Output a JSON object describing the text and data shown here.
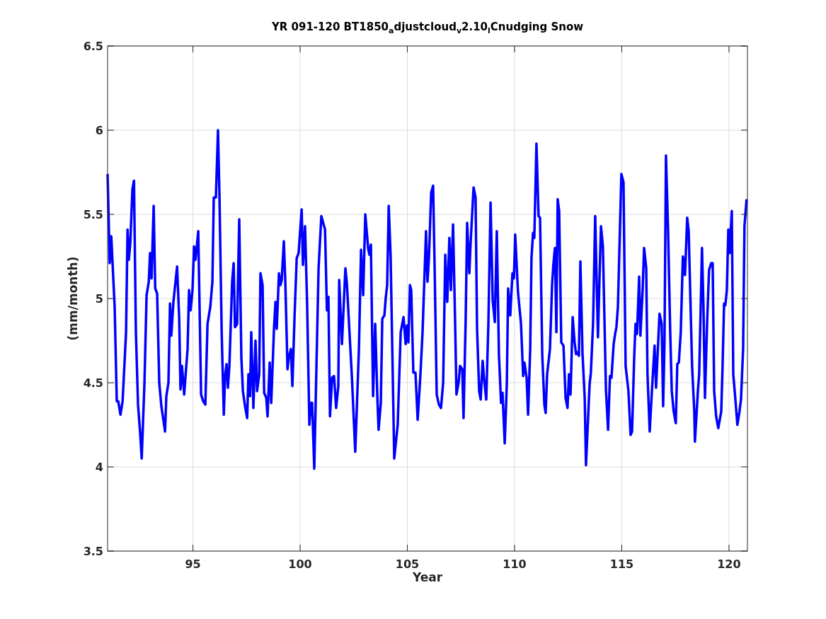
{
  "figure": {
    "chart_data": {
      "type": "line",
      "title": "YR 091-120 BT1850$_{a}$djustcloud$_{v}$2.10$_{l}$Cnudging Snow",
      "xlabel": "Year",
      "ylabel": "(mm/month)",
      "grid": true,
      "xlim": [
        91.02,
        120.86
      ],
      "ylim": [
        3.5,
        6.5
      ],
      "xticks": [
        95,
        100,
        105,
        110,
        115,
        120
      ],
      "yticks": [
        {
          "value": 3.5,
          "label": "3.5"
        },
        {
          "value": 4,
          "label": "4"
        },
        {
          "value": 4.5,
          "label": "4.5"
        },
        {
          "value": 5,
          "label": "5"
        },
        {
          "value": 5.5,
          "label": "5.5"
        },
        {
          "value": 6,
          "label": "6"
        },
        {
          "value": 6.5,
          "label": "6.5"
        }
      ],
      "x": [
        91.02,
        91.12,
        91.19,
        91.35,
        91.45,
        91.52,
        91.62,
        91.72,
        91.88,
        91.95,
        92.01,
        92.08,
        92.18,
        92.25,
        92.34,
        92.44,
        92.54,
        92.61,
        92.74,
        92.84,
        92.94,
        93.0,
        93.07,
        93.17,
        93.24,
        93.33,
        93.43,
        93.53,
        93.7,
        93.76,
        93.86,
        93.93,
        93.99,
        94.09,
        94.26,
        94.36,
        94.42,
        94.49,
        94.59,
        94.75,
        94.82,
        94.89,
        94.98,
        95.05,
        95.12,
        95.25,
        95.38,
        95.48,
        95.58,
        95.68,
        95.81,
        95.91,
        95.97,
        96.07,
        96.17,
        96.24,
        96.34,
        96.44,
        96.5,
        96.57,
        96.63,
        96.7,
        96.83,
        96.9,
        96.96,
        97.06,
        97.16,
        97.26,
        97.33,
        97.43,
        97.53,
        97.59,
        97.66,
        97.72,
        97.82,
        97.92,
        97.99,
        98.09,
        98.15,
        98.25,
        98.32,
        98.42,
        98.48,
        98.58,
        98.65,
        98.78,
        98.85,
        98.91,
        99.01,
        99.08,
        99.14,
        99.24,
        99.31,
        99.41,
        99.47,
        99.57,
        99.64,
        99.74,
        99.84,
        99.93,
        100.07,
        100.13,
        100.23,
        100.33,
        100.43,
        100.5,
        100.56,
        100.66,
        100.76,
        100.86,
        100.99,
        101.16,
        101.25,
        101.32,
        101.39,
        101.49,
        101.58,
        101.68,
        101.78,
        101.82,
        101.95,
        102.11,
        102.18,
        102.28,
        102.41,
        102.57,
        102.74,
        102.84,
        102.94,
        103.04,
        103.17,
        103.23,
        103.3,
        103.4,
        103.5,
        103.6,
        103.66,
        103.76,
        103.83,
        103.93,
        103.99,
        104.06,
        104.13,
        104.22,
        104.39,
        104.55,
        104.69,
        104.82,
        104.92,
        104.98,
        105.05,
        105.12,
        105.18,
        105.28,
        105.38,
        105.48,
        105.61,
        105.71,
        105.87,
        105.94,
        106.01,
        106.11,
        106.2,
        106.27,
        106.37,
        106.47,
        106.57,
        106.67,
        106.77,
        106.86,
        106.96,
        107.03,
        107.13,
        107.23,
        107.29,
        107.39,
        107.46,
        107.56,
        107.62,
        107.72,
        107.79,
        107.89,
        107.95,
        108.09,
        108.18,
        108.25,
        108.35,
        108.42,
        108.51,
        108.58,
        108.68,
        108.78,
        108.88,
        108.98,
        109.08,
        109.17,
        109.27,
        109.37,
        109.44,
        109.54,
        109.64,
        109.7,
        109.8,
        109.9,
        109.97,
        110.03,
        110.16,
        110.3,
        110.4,
        110.46,
        110.56,
        110.63,
        110.73,
        110.79,
        110.86,
        110.92,
        111.02,
        111.12,
        111.19,
        111.29,
        111.39,
        111.45,
        111.52,
        111.65,
        111.75,
        111.81,
        111.88,
        111.95,
        112.01,
        112.08,
        112.18,
        112.28,
        112.38,
        112.47,
        112.54,
        112.61,
        112.71,
        112.8,
        112.87,
        112.94,
        113.0,
        113.07,
        113.17,
        113.27,
        113.33,
        113.5,
        113.56,
        113.66,
        113.76,
        113.89,
        113.96,
        114.03,
        114.12,
        114.26,
        114.36,
        114.45,
        114.52,
        114.62,
        114.69,
        114.75,
        114.82,
        114.98,
        115.08,
        115.18,
        115.31,
        115.41,
        115.48,
        115.58,
        115.64,
        115.71,
        115.81,
        115.87,
        115.97,
        116.04,
        116.14,
        116.2,
        116.3,
        116.4,
        116.53,
        116.6,
        116.76,
        116.86,
        116.93,
        116.99,
        117.06,
        117.16,
        117.26,
        117.33,
        117.42,
        117.52,
        117.59,
        117.66,
        117.75,
        117.85,
        117.95,
        118.05,
        118.12,
        118.18,
        118.28,
        118.38,
        118.41,
        118.55,
        118.61,
        118.68,
        118.74,
        118.81,
        118.88,
        118.98,
        119.07,
        119.17,
        119.24,
        119.31,
        119.4,
        119.5,
        119.64,
        119.7,
        119.77,
        119.83,
        119.9,
        119.97,
        120.03,
        120.13,
        120.2,
        120.3,
        120.39,
        120.49,
        120.56,
        120.66,
        120.72,
        120.82
      ],
      "series": [
        {
          "color": "#0000ff",
          "values": [
            5.74,
            5.21,
            5.37,
            4.95,
            4.39,
            4.39,
            4.31,
            4.39,
            4.8,
            5.41,
            5.23,
            5.33,
            5.65,
            5.7,
            4.8,
            4.37,
            4.2,
            4.05,
            4.5,
            5.02,
            5.1,
            5.27,
            5.12,
            5.55,
            5.06,
            5.03,
            4.5,
            4.36,
            4.21,
            4.42,
            4.5,
            4.97,
            4.78,
            4.98,
            5.19,
            4.88,
            4.46,
            4.6,
            4.43,
            4.7,
            5.05,
            4.93,
            5.05,
            5.31,
            5.23,
            5.4,
            4.43,
            4.39,
            4.37,
            4.85,
            4.95,
            5.1,
            5.6,
            5.6,
            6.0,
            5.6,
            4.8,
            4.31,
            4.54,
            4.61,
            4.47,
            4.6,
            5.1,
            5.21,
            4.83,
            4.85,
            5.47,
            4.65,
            4.45,
            4.36,
            4.29,
            4.55,
            4.42,
            4.8,
            4.35,
            4.75,
            4.45,
            4.55,
            5.15,
            5.08,
            4.44,
            4.41,
            4.3,
            4.62,
            4.38,
            4.82,
            4.98,
            4.82,
            5.15,
            5.08,
            5.11,
            5.34,
            5.1,
            4.58,
            4.65,
            4.7,
            4.48,
            4.9,
            5.24,
            5.27,
            5.53,
            5.2,
            5.43,
            4.95,
            4.25,
            4.38,
            4.38,
            3.99,
            4.6,
            5.18,
            5.49,
            5.41,
            4.93,
            5.01,
            4.3,
            4.53,
            4.54,
            4.35,
            4.48,
            5.11,
            4.73,
            5.18,
            5.09,
            4.85,
            4.54,
            4.09,
            4.7,
            5.29,
            5.02,
            5.5,
            5.3,
            5.26,
            5.32,
            4.42,
            4.85,
            4.42,
            4.22,
            4.38,
            4.88,
            4.9,
            5.0,
            5.08,
            5.55,
            5.25,
            4.05,
            4.25,
            4.8,
            4.89,
            4.73,
            4.84,
            4.74,
            5.08,
            5.05,
            4.56,
            4.56,
            4.28,
            4.55,
            4.8,
            5.4,
            5.1,
            5.25,
            5.63,
            5.67,
            5.2,
            4.43,
            4.37,
            4.35,
            4.5,
            5.26,
            4.98,
            5.36,
            5.05,
            5.44,
            4.84,
            4.43,
            4.5,
            4.6,
            4.58,
            4.29,
            4.87,
            5.45,
            5.15,
            5.33,
            5.66,
            5.6,
            4.82,
            4.45,
            4.4,
            4.63,
            4.52,
            4.4,
            4.85,
            5.57,
            4.99,
            4.86,
            5.4,
            4.67,
            4.38,
            4.44,
            4.14,
            4.5,
            5.06,
            4.9,
            5.15,
            5.12,
            5.38,
            5.04,
            4.85,
            4.54,
            4.62,
            4.53,
            4.31,
            4.7,
            5.24,
            5.39,
            5.36,
            5.92,
            5.49,
            5.48,
            4.67,
            4.37,
            4.32,
            4.55,
            4.7,
            5.08,
            5.2,
            5.3,
            4.8,
            5.59,
            5.52,
            4.74,
            4.72,
            4.41,
            4.35,
            4.55,
            4.43,
            4.89,
            4.74,
            4.67,
            4.68,
            4.66,
            5.22,
            4.67,
            4.41,
            4.01,
            4.49,
            4.56,
            4.85,
            5.49,
            4.77,
            5.12,
            5.43,
            5.31,
            4.46,
            4.22,
            4.54,
            4.53,
            4.73,
            4.79,
            4.83,
            4.95,
            5.74,
            5.69,
            4.6,
            4.45,
            4.19,
            4.21,
            4.65,
            4.85,
            4.79,
            5.13,
            4.78,
            5.05,
            5.3,
            5.18,
            4.55,
            4.21,
            4.44,
            4.72,
            4.47,
            4.91,
            4.85,
            4.36,
            4.73,
            5.85,
            5.4,
            4.8,
            4.45,
            4.33,
            4.26,
            4.61,
            4.62,
            4.8,
            5.25,
            5.14,
            5.48,
            5.4,
            5.1,
            4.6,
            4.33,
            4.15,
            4.45,
            4.55,
            4.95,
            5.3,
            4.95,
            4.41,
            4.85,
            5.17,
            5.21,
            5.21,
            4.45,
            4.3,
            4.23,
            4.33,
            4.6,
            4.97,
            4.96,
            5.05,
            5.41,
            5.27,
            5.52,
            4.55,
            4.4,
            4.25,
            4.33,
            4.4,
            4.7,
            5.43,
            5.59
          ]
        }
      ]
    }
  }
}
